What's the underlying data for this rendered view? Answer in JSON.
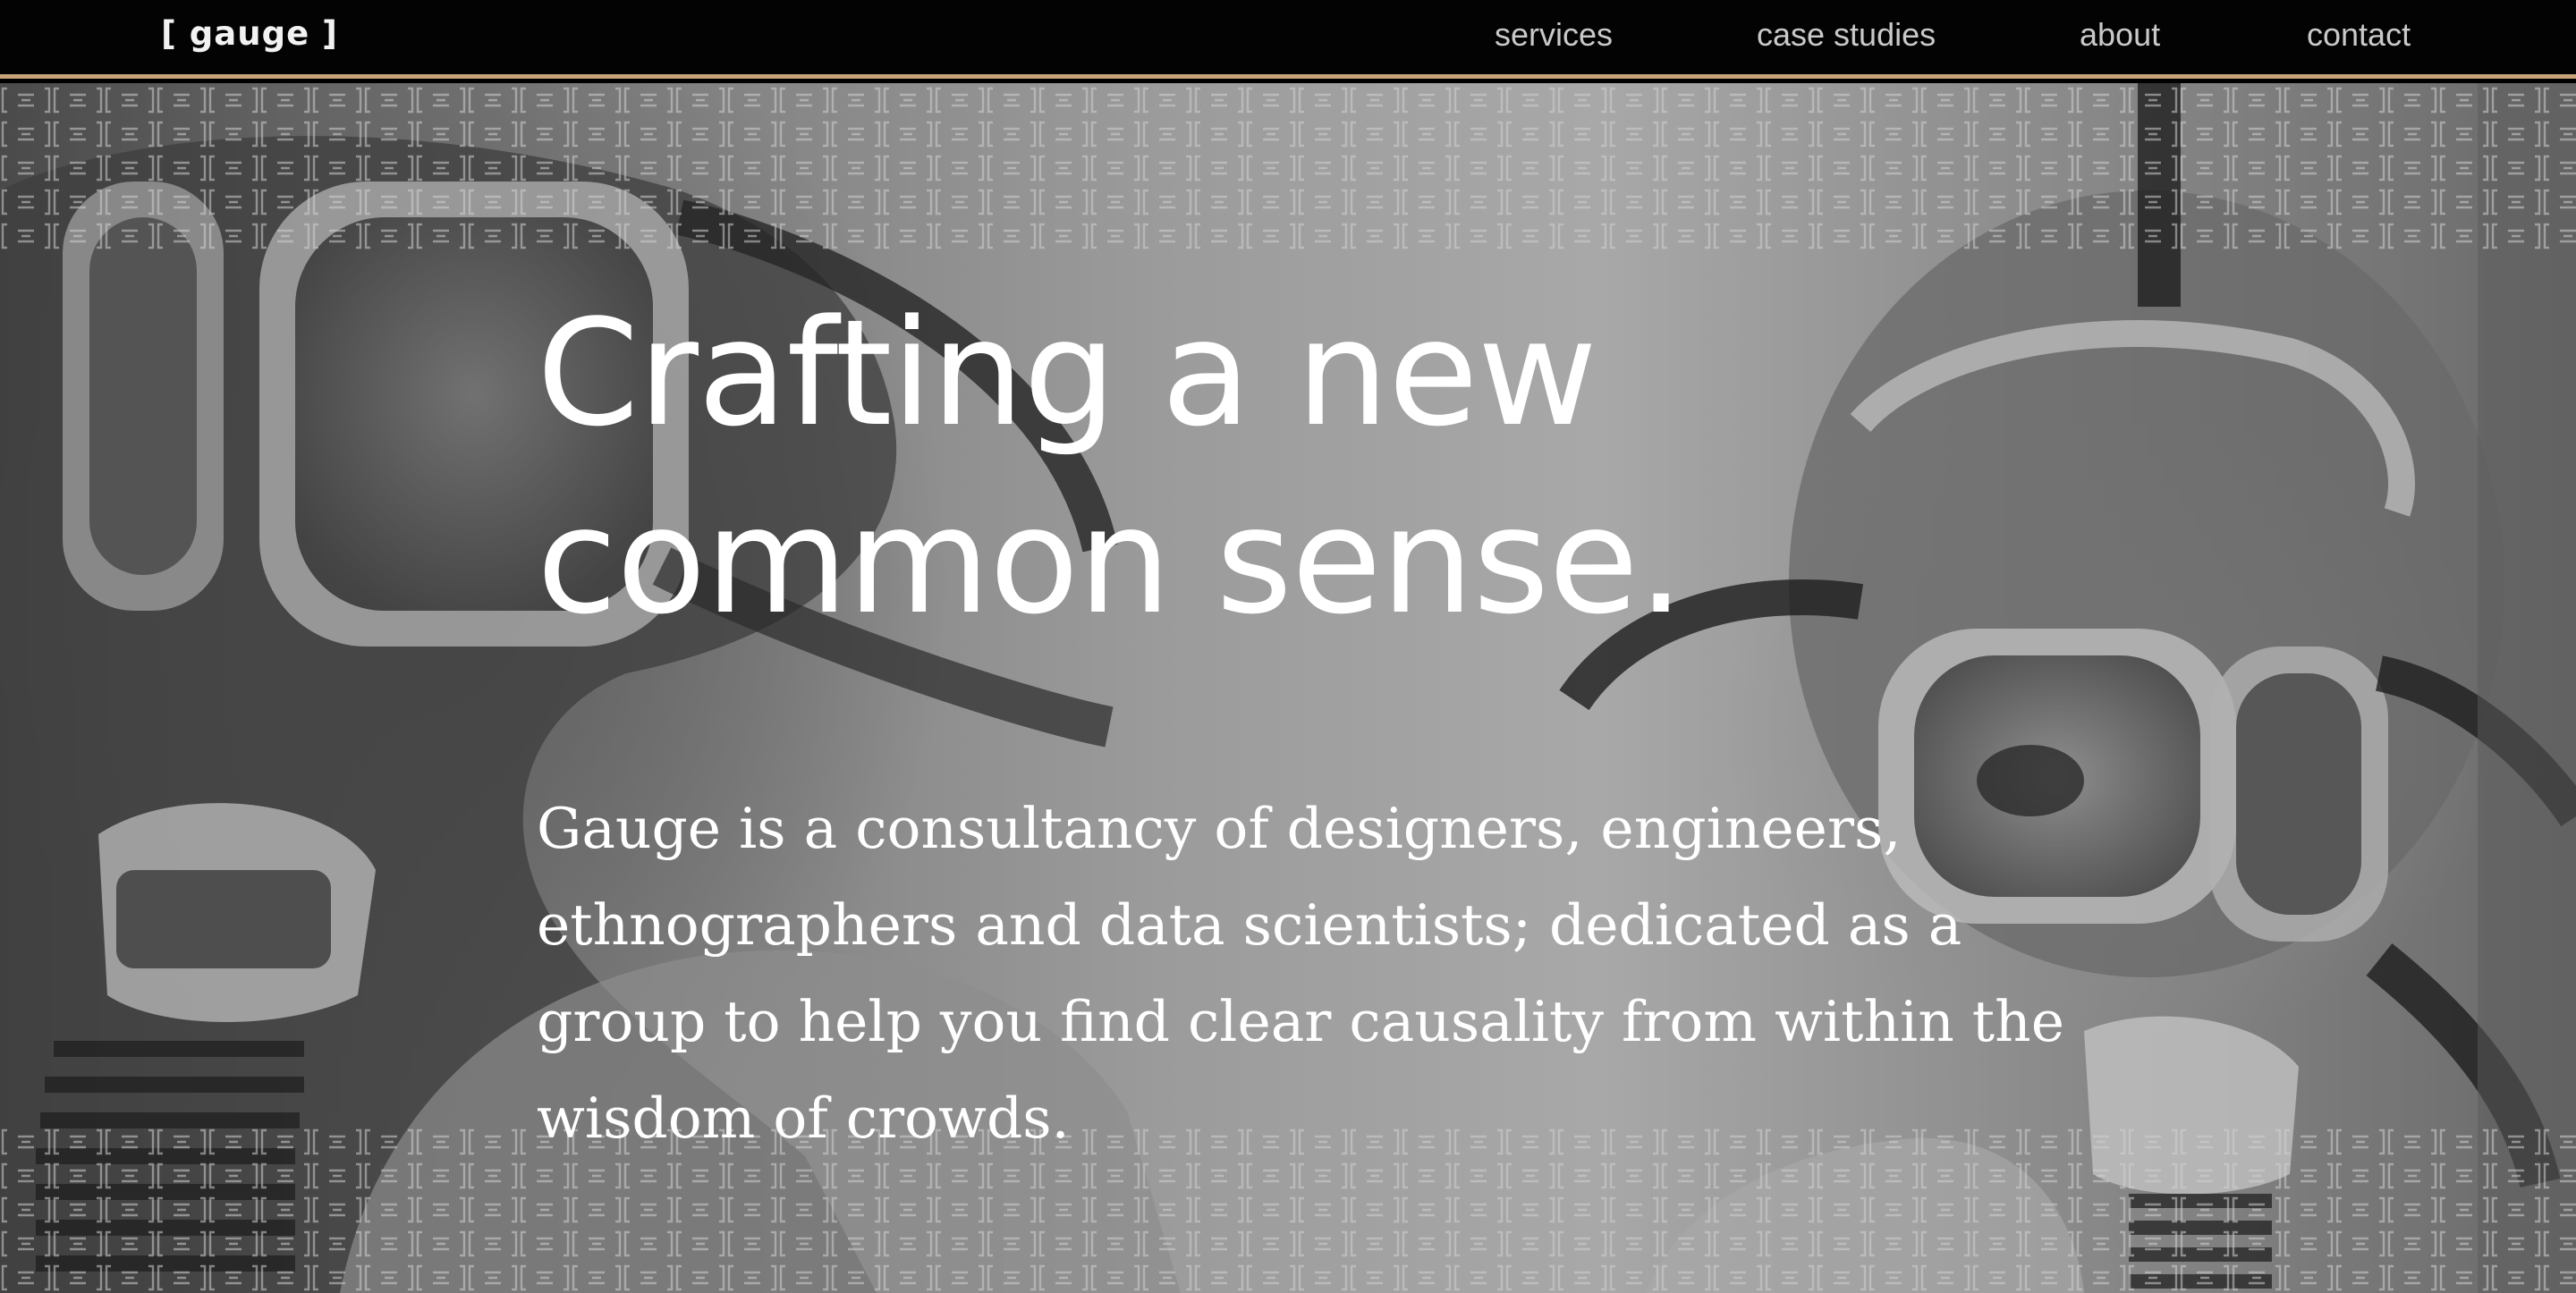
{
  "nav": {
    "logo": "[ gauge ]",
    "links": [
      {
        "label": "services"
      },
      {
        "label": "case studies"
      },
      {
        "label": "about"
      },
      {
        "label": "contact"
      }
    ]
  },
  "hero": {
    "title": "Crafting a new common sense.",
    "description": "Gauge is a consultancy of designers, engineers, ethnographers and data scientists; dedicated as a group to help you find clear causality from within the wisdom of crowds.",
    "background": "black-and-white-photo-divers-in-masks"
  },
  "colors": {
    "nav_background": "#030303",
    "nav_border": "#c8a37a",
    "nav_text": "#c9c9c9",
    "hero_text": "#ffffff"
  }
}
